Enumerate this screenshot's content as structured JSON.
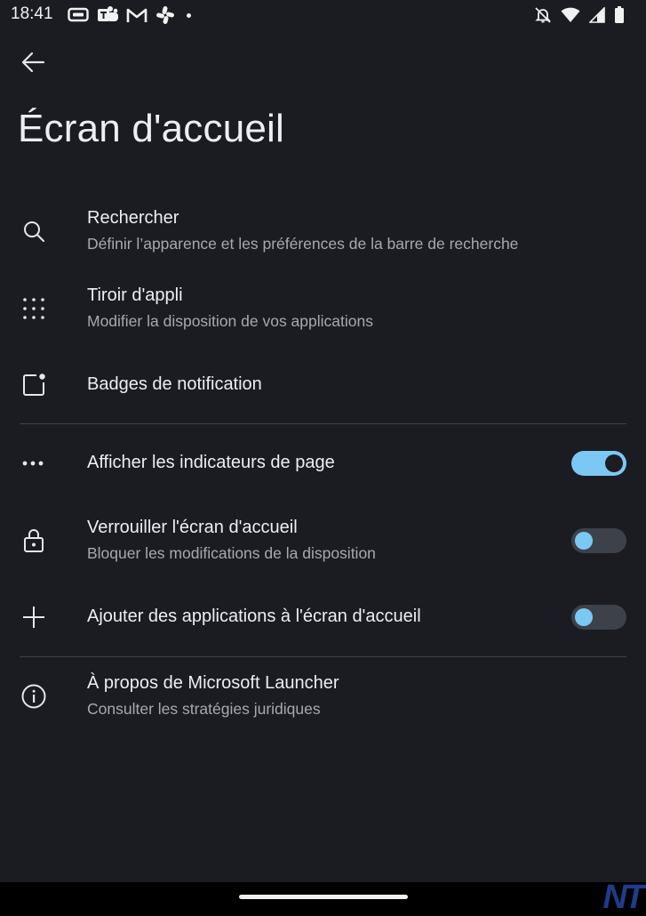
{
  "status_bar": {
    "time": "18:41",
    "left_icons": [
      "hdmi-icon",
      "teams-icon",
      "gmail-icon",
      "slack-icon",
      "dot-icon"
    ],
    "right_icons": [
      "silent-bell-icon",
      "wifi-icon",
      "signal-icon",
      "battery-icon"
    ]
  },
  "header": {
    "title": "Écran d'accueil"
  },
  "settings": {
    "search": {
      "title": "Rechercher",
      "subtitle": "Définir l’apparence et les préférences de la barre de recherche",
      "icon": "search-icon"
    },
    "app_drawer": {
      "title": "Tiroir d'appli",
      "subtitle": "Modifier la disposition de vos applications",
      "icon": "grid-icon"
    },
    "notification_badges": {
      "title": "Badges de notification",
      "icon": "badge-icon"
    },
    "page_indicators": {
      "title": "Afficher les indicateurs de page",
      "icon": "dots-icon",
      "enabled": true
    },
    "lock_home": {
      "title": "Verrouiller l'écran d'accueil",
      "subtitle": "Bloquer les modifications de la disposition",
      "icon": "lock-icon",
      "enabled": false
    },
    "add_apps": {
      "title": "Ajouter des applications à l'écran d'accueil",
      "icon": "plus-icon",
      "enabled": false
    },
    "about": {
      "title": "À propos de Microsoft Launcher",
      "subtitle": "Consulter les stratégies juridiques",
      "icon": "info-icon"
    }
  },
  "colors": {
    "background": "#1a1c22",
    "accent": "#7cc8f5",
    "text_primary": "#eceef1",
    "text_secondary": "#a6a9b0",
    "divider": "#3e414a"
  },
  "watermark": {
    "text": "NT"
  }
}
